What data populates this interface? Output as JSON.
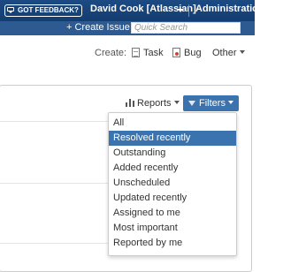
{
  "header": {
    "feedback_label": "GOT FEEDBACK?",
    "user_name": "David Cook [Atlassian]",
    "admin_label": "Administration",
    "create_issue_label": "+ Create Issue",
    "search_placeholder": "Quick Search"
  },
  "create_bar": {
    "label": "Create:",
    "task_label": "Task",
    "bug_label": "Bug",
    "other_label": "Other"
  },
  "toolbar": {
    "reports_label": "Reports",
    "filters_label": "Filters"
  },
  "filters_menu": {
    "items": [
      "All",
      "Resolved recently",
      "Outstanding",
      "Added recently",
      "Unscheduled",
      "Updated recently",
      "Assigned to me",
      "Most important",
      "Reported by me"
    ],
    "active": "Resolved recently"
  },
  "colors": {
    "header_bg": "#1c4a83",
    "subbar_bg": "#2d5a90",
    "accent": "#3b73af"
  }
}
